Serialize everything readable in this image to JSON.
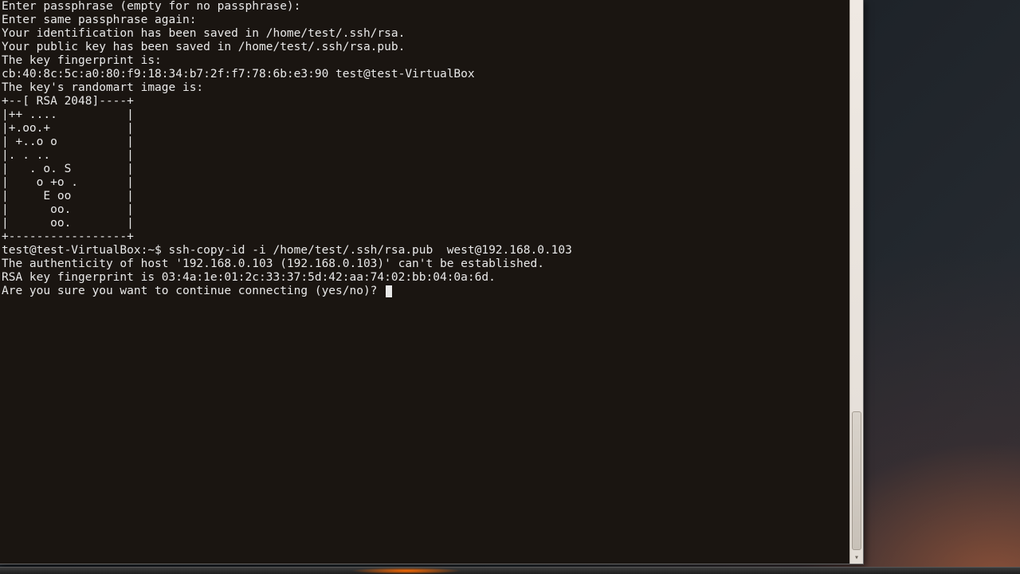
{
  "prompt_user_host": "test@test-VirtualBox",
  "prompt_path": "~",
  "prompt_symbol": "$",
  "command": "ssh-copy-id -i /home/test/.ssh/rsa.pub  west@192.168.0.103",
  "lines": [
    "Enter passphrase (empty for no passphrase):",
    "Enter same passphrase again:",
    "Your identification has been saved in /home/test/.ssh/rsa.",
    "Your public key has been saved in /home/test/.ssh/rsa.pub.",
    "The key fingerprint is:",
    "cb:40:8c:5c:a0:80:f9:18:34:b7:2f:f7:78:6b:e3:90 test@test-VirtualBox",
    "The key's randomart image is:",
    "+--[ RSA 2048]----+",
    "|++ ....          |",
    "|+.oo.+           |",
    "| +..o o          |",
    "|. . ..           |",
    "|   . o. S        |",
    "|    o +o .       |",
    "|     E oo        |",
    "|      oo.        |",
    "|      oo.        |",
    "+-----------------+"
  ],
  "after_lines": [
    "The authenticity of host '192.168.0.103 (192.168.0.103)' can't be established.",
    "RSA key fingerprint is 03:4a:1e:01:2c:33:37:5d:42:aa:74:02:bb:04:0a:6d.",
    "Are you sure you want to continue connecting (yes/no)? "
  ]
}
